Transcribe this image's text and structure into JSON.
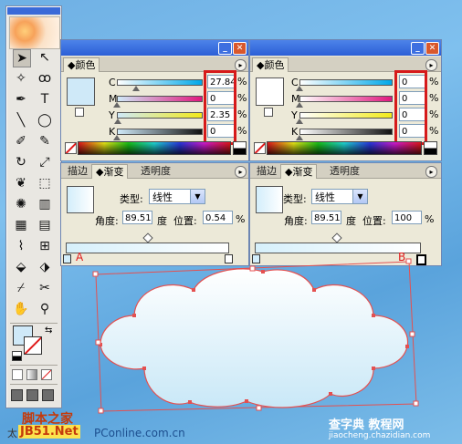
{
  "colors": {
    "accent_red": "#d61a1a",
    "titlebar_blue": "#2c5fd6",
    "cloud_fill": "#d9eff9",
    "cloud_stroke": "#e45050"
  },
  "toolbox": {
    "tools": [
      {
        "name": "selection-tool-icon",
        "glyph": "➤"
      },
      {
        "name": "direct-selection-tool-icon",
        "glyph": "↖"
      },
      {
        "name": "magic-wand-tool-icon",
        "glyph": "✧"
      },
      {
        "name": "lasso-tool-icon",
        "glyph": "ꝏ"
      },
      {
        "name": "pen-tool-icon",
        "glyph": "✒"
      },
      {
        "name": "type-tool-icon",
        "glyph": "T"
      },
      {
        "name": "line-tool-icon",
        "glyph": "╲"
      },
      {
        "name": "ellipse-tool-icon",
        "glyph": "◯"
      },
      {
        "name": "paintbrush-tool-icon",
        "glyph": "✐"
      },
      {
        "name": "pencil-tool-icon",
        "glyph": "✎"
      },
      {
        "name": "rotate-tool-icon",
        "glyph": "↻"
      },
      {
        "name": "scale-tool-icon",
        "glyph": "⤢"
      },
      {
        "name": "warp-tool-icon",
        "glyph": "❦"
      },
      {
        "name": "free-transform-tool-icon",
        "glyph": "⬚"
      },
      {
        "name": "symbol-sprayer-tool-icon",
        "glyph": "✺"
      },
      {
        "name": "column-graph-tool-icon",
        "glyph": "▥"
      },
      {
        "name": "mesh-tool-icon",
        "glyph": "▦"
      },
      {
        "name": "gradient-tool-icon",
        "glyph": "▤"
      },
      {
        "name": "eyedropper-tool-icon",
        "glyph": "⌇"
      },
      {
        "name": "blend-tool-icon",
        "glyph": "⊞"
      },
      {
        "name": "live-paint-bucket-tool-icon",
        "glyph": "⬙"
      },
      {
        "name": "live-paint-selection-tool-icon",
        "glyph": "⬗"
      },
      {
        "name": "slice-tool-icon",
        "glyph": "⌿"
      },
      {
        "name": "scissors-tool-icon",
        "glyph": "✂"
      },
      {
        "name": "hand-tool-icon",
        "glyph": "✋"
      },
      {
        "name": "zoom-tool-icon",
        "glyph": "⚲"
      }
    ]
  },
  "color_panel_left": {
    "tab": "颜色",
    "menu_arrow": "▸",
    "channels": [
      {
        "letter": "C",
        "value": "27.84",
        "unit": "%"
      },
      {
        "letter": "M",
        "value": "0",
        "unit": "%"
      },
      {
        "letter": "Y",
        "value": "2.35",
        "unit": "%"
      },
      {
        "letter": "K",
        "value": "0",
        "unit": "%"
      }
    ]
  },
  "color_panel_right": {
    "tab": "颜色",
    "menu_arrow": "▸",
    "channels": [
      {
        "letter": "C",
        "value": "0",
        "unit": "%"
      },
      {
        "letter": "M",
        "value": "0",
        "unit": "%"
      },
      {
        "letter": "Y",
        "value": "0",
        "unit": "%"
      },
      {
        "letter": "K",
        "value": "0",
        "unit": "%"
      }
    ]
  },
  "gradient_panel_left": {
    "tabs": [
      "描边",
      "渐变",
      "透明度"
    ],
    "type_label": "类型:",
    "type_value": "线性",
    "angle_label": "角度:",
    "angle_value": "89.51",
    "angle_unit": "度",
    "position_label": "位置:",
    "position_value": "0.54",
    "position_unit": "%",
    "marker": "A"
  },
  "gradient_panel_right": {
    "tabs": [
      "描边",
      "渐变",
      "透明度"
    ],
    "type_label": "类型:",
    "type_value": "线性",
    "angle_label": "角度:",
    "angle_value": "89.51",
    "angle_unit": "度",
    "position_label": "位置:",
    "position_value": "100",
    "position_unit": "%",
    "marker": "B"
  },
  "watermarks": {
    "left_top": "脚本之家",
    "left_bottom": "JB51.Net",
    "left_prefix": "太",
    "middle": "PConline.com.cn",
    "right_top": "查字典 教程网",
    "right_bottom": "jiaocheng.chazidian.com"
  }
}
